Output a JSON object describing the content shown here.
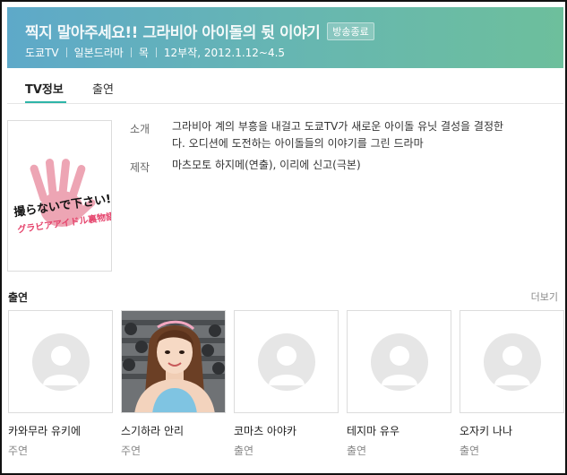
{
  "header": {
    "title": "찍지 말아주세요!! 그라비아 아이돌의 뒷 이야기",
    "badge": "방송종료",
    "meta": {
      "channel": "도쿄TV",
      "genre": "일본드라마",
      "day": "목",
      "info": "12부작, 2012.1.12~4.5"
    }
  },
  "tabs": [
    {
      "label": "TV정보"
    },
    {
      "label": "출연"
    }
  ],
  "info": {
    "intro_label": "소개",
    "intro_line1": "그라비아 계의 부흥을 내걸고 도쿄TV가 새로운 아이돌 유닛 결성을 결정한",
    "intro_line2": "다. 오디션에 도전하는 아이돌들의 이야기를 그린 드라마",
    "prod_label": "제작",
    "prod_text": "마츠모토 하지메(연출), 이리에 신고(극본)"
  },
  "poster": {
    "line1": "撮らないで下さい!!",
    "line2": "グラビアアイドル裏物語",
    "accent": "#e5426b"
  },
  "cast_section": {
    "title": "출연",
    "more": "더보기"
  },
  "cast": [
    {
      "name": "카와무라 유키에",
      "role": "주연",
      "photo": false
    },
    {
      "name": "스기하라 안리",
      "role": "주연",
      "photo": true
    },
    {
      "name": "코마츠 아야카",
      "role": "출연",
      "photo": false
    },
    {
      "name": "테지마 유우",
      "role": "출연",
      "photo": false
    },
    {
      "name": "오자키 나나",
      "role": "출연",
      "photo": false
    }
  ],
  "colors": {
    "header_start": "#5ea9c9",
    "header_end": "#6dbf9c",
    "tab_accent": "#2eb5a8"
  }
}
